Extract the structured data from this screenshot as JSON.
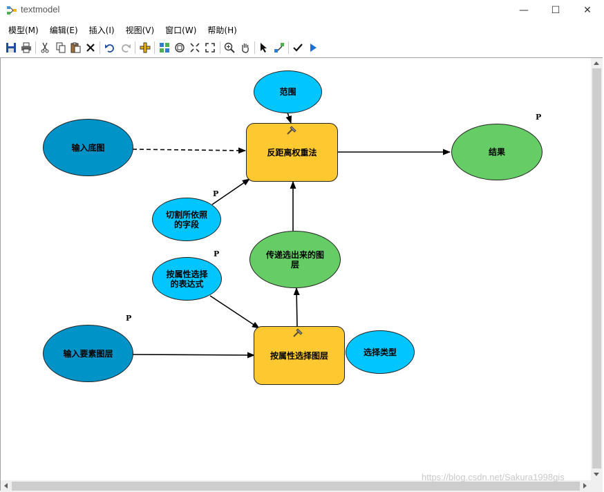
{
  "window": {
    "title": "textmodel",
    "minimize": "—",
    "maximize": "☐",
    "close": "✕"
  },
  "menubar": {
    "items": [
      "模型(M)",
      "编辑(E)",
      "插入(I)",
      "视图(V)",
      "窗口(W)",
      "帮助(H)"
    ]
  },
  "toolbar": {
    "icons": [
      "save-icon",
      "print-icon",
      "cut-icon",
      "copy-icon",
      "paste-icon",
      "delete-icon",
      "undo-icon",
      "redo-icon",
      "add-data-icon",
      "auto-layout-icon",
      "full-extent-icon",
      "zoom-in-fixed-icon",
      "zoom-out-fixed-icon",
      "zoom-in-icon",
      "pan-icon",
      "select-icon",
      "connect-icon",
      "validate-icon",
      "run-icon"
    ]
  },
  "diagram": {
    "nodes": {
      "range": "范围",
      "idw": "反距离权重法",
      "result": "结果",
      "input_base": "输入底图",
      "cut_field": "切割所依照的字段",
      "passed_layer": "传递选出来的图层",
      "attr_expr": "按属性选择的表达式",
      "input_layer": "输入要素图层",
      "select_by_attr": "按属性选择图层",
      "select_type": "选择类型"
    },
    "param_flag": "P",
    "colors": {
      "blue": "#0093C8",
      "cyan": "#00C5FF",
      "green": "#66CC66",
      "orange": "#FDC830"
    }
  },
  "watermark": "https://blog.csdn.net/Sakura1998gis"
}
